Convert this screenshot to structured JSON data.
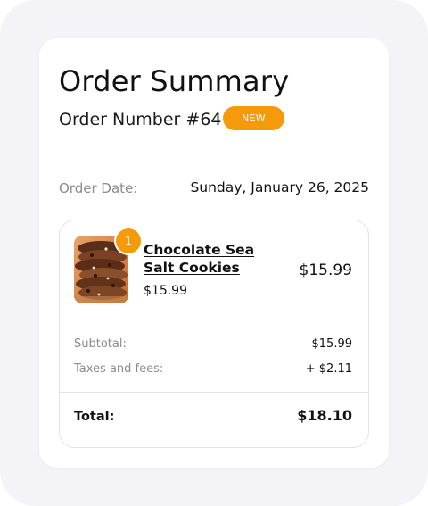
{
  "summary": {
    "title": "Order Summary",
    "order_number": "Order Number #64",
    "status_badge": "NEW",
    "date_label": "Order Date:",
    "date_value": "Sunday, January 26, 2025"
  },
  "items": [
    {
      "name": "Chocolate Sea Salt Cookies",
      "quantity": "1",
      "unit_price": "$15.99",
      "line_total": "$15.99",
      "image": "cookie-stack-photo"
    }
  ],
  "totals": {
    "subtotal_label": "Subtotal:",
    "subtotal_value": "$15.99",
    "tax_label": "Taxes and fees:",
    "tax_value": "+ $2.11",
    "total_label": "Total:",
    "total_value": "$18.10"
  },
  "colors": {
    "accent": "#f59a0a",
    "background": "#f4f3f7",
    "card": "#ffffff",
    "muted_text": "#8a8a8f",
    "border": "#e4e3e8"
  }
}
